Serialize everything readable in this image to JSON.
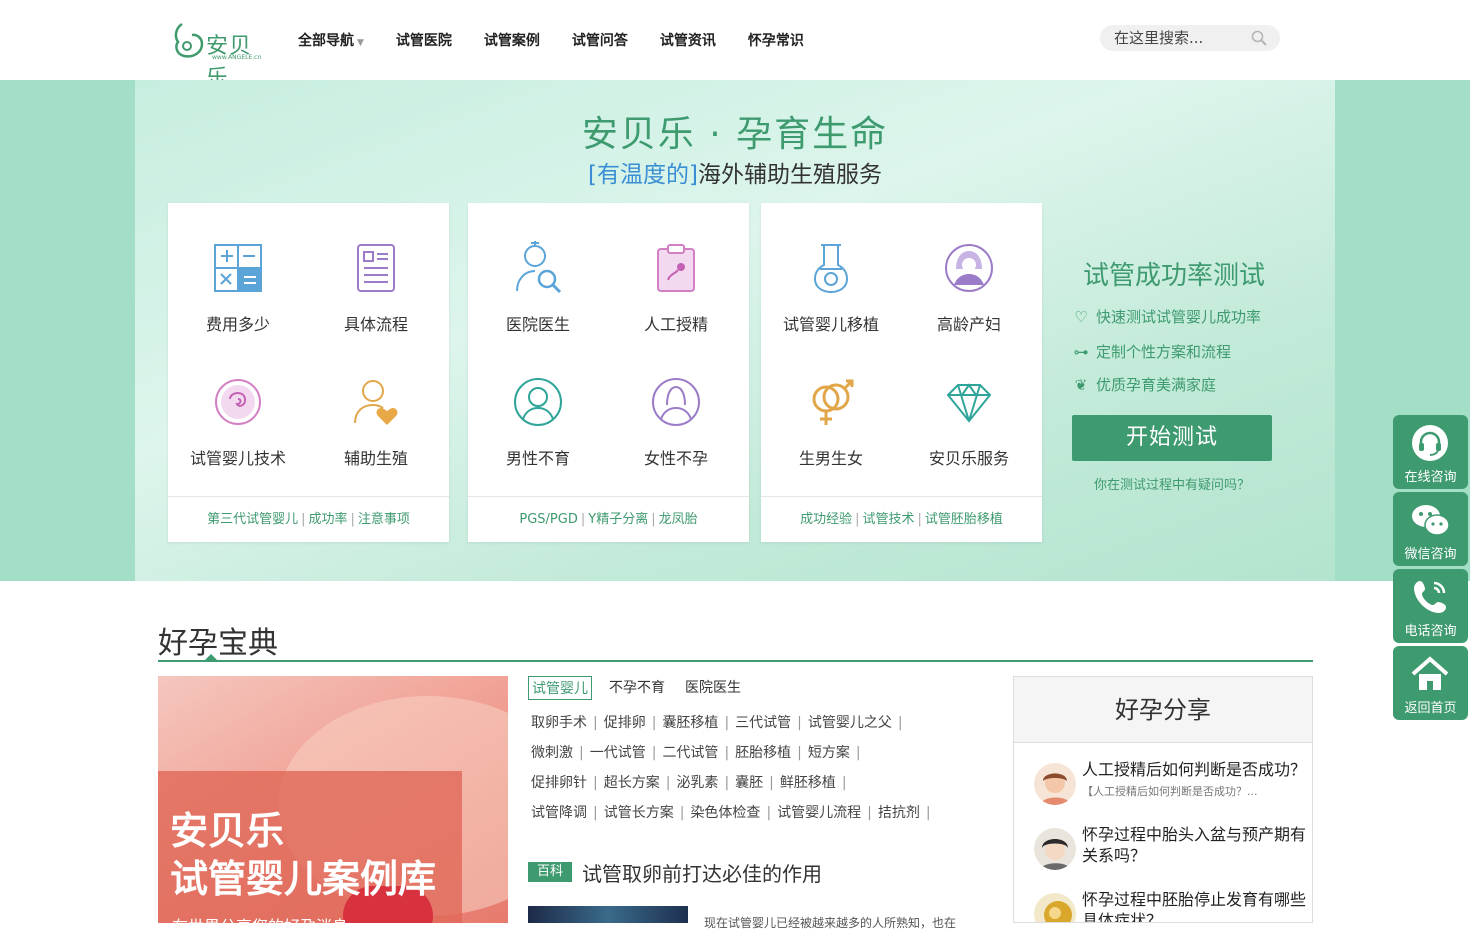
{
  "header": {
    "logo_text": "安贝乐",
    "logo_url": "www.ANGELE.cn",
    "nav": [
      {
        "label": "全部导航",
        "has_dropdown": true
      },
      {
        "label": "试管医院"
      },
      {
        "label": "试管案例"
      },
      {
        "label": "试管问答"
      },
      {
        "label": "试管资讯"
      },
      {
        "label": "怀孕常识"
      }
    ],
    "search_placeholder": "在这里搜索..."
  },
  "hero": {
    "title": "安贝乐 · 孕育生命",
    "subtitle_highlight": "[有温度的]",
    "subtitle_rest": "海外辅助生殖服务"
  },
  "cards": [
    {
      "items": [
        {
          "label": "费用多少",
          "icon": "calculator-icon"
        },
        {
          "label": "具体流程",
          "icon": "document-list-icon"
        },
        {
          "label": "试管婴儿技术",
          "icon": "embryo-icon"
        },
        {
          "label": "辅助生殖",
          "icon": "woman-heart-icon"
        }
      ],
      "footer": [
        "第三代试管婴儿",
        "成功率",
        "注意事项"
      ]
    },
    {
      "items": [
        {
          "label": "医院医生",
          "icon": "doctor-search-icon"
        },
        {
          "label": "人工授精",
          "icon": "clipboard-sperm-icon"
        },
        {
          "label": "男性不育",
          "icon": "male-avatar-icon"
        },
        {
          "label": "女性不孕",
          "icon": "female-avatar-icon"
        }
      ],
      "footer": [
        "PGS/PGD",
        "Y精子分离",
        "龙凤胎"
      ]
    },
    {
      "items": [
        {
          "label": "试管婴儿移植",
          "icon": "flask-icon"
        },
        {
          "label": "高龄产妇",
          "icon": "elder-woman-icon"
        },
        {
          "label": "生男生女",
          "icon": "gender-symbol-icon"
        },
        {
          "label": "安贝乐服务",
          "icon": "diamond-icon"
        }
      ],
      "footer": [
        "成功经验",
        "试管技术",
        "试管胚胎移植"
      ]
    }
  ],
  "test": {
    "title": "试管成功率测试",
    "points": [
      {
        "text": "快速测试试管婴儿成功率",
        "icon": "heart-hand-icon"
      },
      {
        "text": "定制个性方案和流程",
        "icon": "share-nodes-icon"
      },
      {
        "text": "优质孕育美满家庭",
        "icon": "family-icon"
      }
    ],
    "button": "开始测试",
    "question": "你在测试过程中有疑问吗？"
  },
  "section": {
    "title": "好孕宝典",
    "promo": {
      "line1": "安贝乐",
      "line2": "试管婴儿案例库",
      "line3": "在世界分享您的好孕消息"
    },
    "tabs": [
      "试管婴儿",
      "不孕不育",
      "医院医生"
    ],
    "active_tab": 0,
    "keywords": [
      [
        "取卵手术",
        "促排卵",
        "囊胚移植",
        "三代试管",
        "试管婴儿之父"
      ],
      [
        "微刺激",
        "一代试管",
        "二代试管",
        "胚胎移植",
        "短方案"
      ],
      [
        "促排卵针",
        "超长方案",
        "泌乳素",
        "囊胚",
        "鲜胚移植"
      ],
      [
        "试管降调",
        "试管长方案",
        "染色体检查",
        "试管婴儿流程",
        "拮抗剂"
      ]
    ],
    "baike": {
      "tag": "百科",
      "title": "试管取卵前打达必佳的作用",
      "excerpt": "现在试管婴儿已经被越来越多的人所熟知，也在"
    }
  },
  "share": {
    "title": "好孕分享",
    "items": [
      {
        "title": "人工授精后如何判断是否成功？",
        "desc": "【人工授精后如何判断是否成功？..."
      },
      {
        "title": "怀孕过程中胎头入盆与预产期有关系吗？",
        "desc": ""
      },
      {
        "title": "怀孕过程中胚胎停止发育有哪些具体症状？",
        "desc": ""
      }
    ]
  },
  "float": [
    {
      "label": "在线咨询",
      "icon": "headset-icon"
    },
    {
      "label": "微信咨询",
      "icon": "wechat-icon"
    },
    {
      "label": "电话咨询",
      "icon": "phone-icon"
    },
    {
      "label": "返回首页",
      "icon": "home-icon"
    }
  ],
  "colors": {
    "brand": "#3e9a6f",
    "accent_blue": "#3a8fd4"
  }
}
